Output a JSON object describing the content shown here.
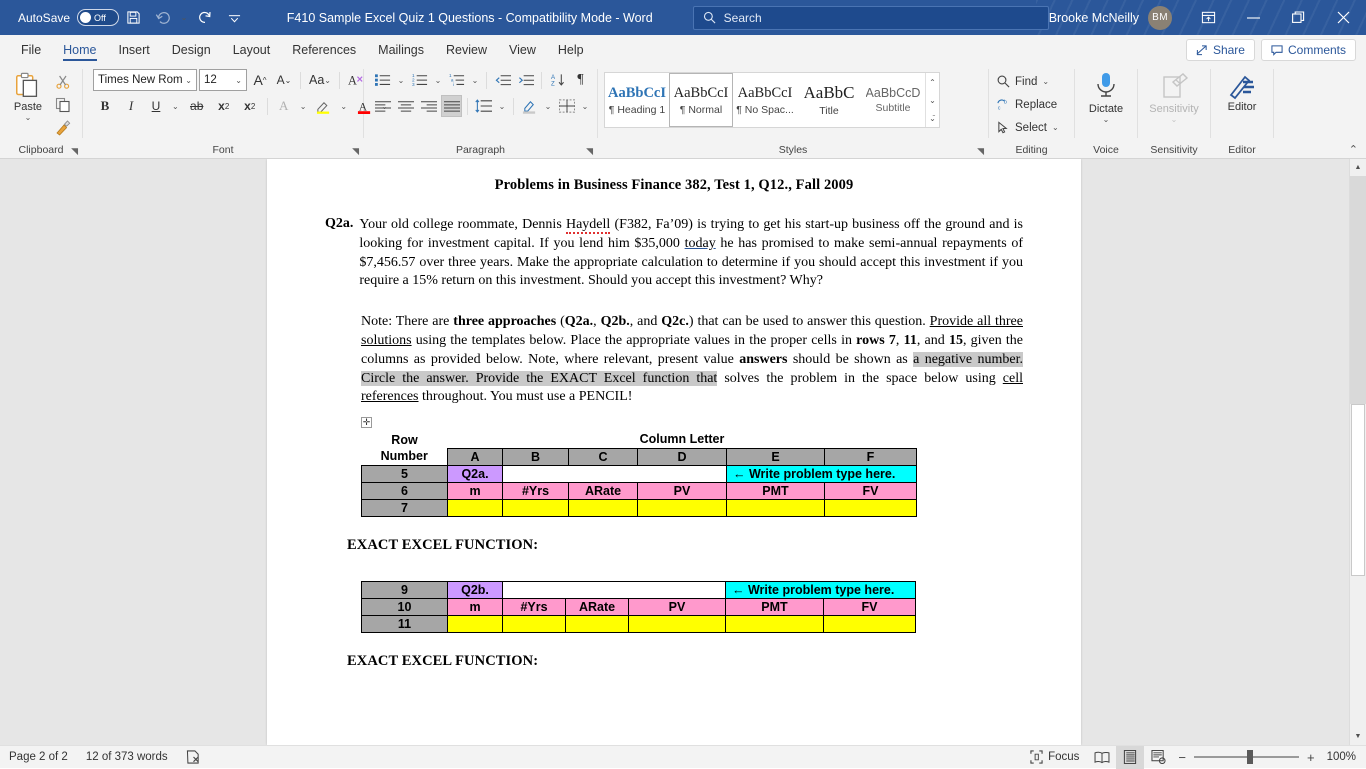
{
  "titlebar": {
    "autosave_label": "AutoSave",
    "autosave_state": "Off",
    "save_icon": "save-icon",
    "undo_icon": "undo-icon",
    "redo_icon": "redo-icon",
    "customize_icon": "customize-quick-access-icon",
    "document_title": "F410 Sample Excel Quiz 1 Questions  -  Compatibility Mode  -  Word",
    "search_placeholder": "Search",
    "search_icon": "search-icon",
    "user_name": "Brooke McNeilly",
    "user_initials": "BM",
    "ribbon_display_icon": "ribbon-display-options-icon",
    "minimize_icon": "minimize-icon",
    "restore_icon": "restore-icon",
    "close_icon": "close-icon"
  },
  "tabs": {
    "items": [
      {
        "label": "File",
        "active": false
      },
      {
        "label": "Home",
        "active": true
      },
      {
        "label": "Insert",
        "active": false
      },
      {
        "label": "Design",
        "active": false
      },
      {
        "label": "Layout",
        "active": false
      },
      {
        "label": "References",
        "active": false
      },
      {
        "label": "Mailings",
        "active": false
      },
      {
        "label": "Review",
        "active": false
      },
      {
        "label": "View",
        "active": false
      },
      {
        "label": "Help",
        "active": false
      }
    ],
    "share_label": "Share",
    "comments_label": "Comments"
  },
  "ribbon": {
    "clipboard": {
      "group_label": "Clipboard",
      "paste_label": "Paste",
      "cut_icon": "cut-scissors-icon",
      "copy_icon": "copy-icon",
      "format_painter_icon": "format-painter-icon"
    },
    "font": {
      "group_label": "Font",
      "font_name": "Times New Rom",
      "font_size": "12",
      "grow_font": "A",
      "shrink_font": "A",
      "change_case": "Aa",
      "clear_formatting_icon": "clear-formatting-icon",
      "bold": "B",
      "italic": "I",
      "underline": "U",
      "strikethrough": "ab",
      "subscript": "x",
      "superscript": "x",
      "text_effects": "A",
      "highlight_color": "A",
      "font_color": "A",
      "highlight_hex": "#ffff00",
      "font_color_hex": "#ff0000"
    },
    "paragraph": {
      "group_label": "Paragraph",
      "bullets_icon": "bullet-list-icon",
      "numbering_icon": "numbered-list-icon",
      "multilevel_icon": "multilevel-list-icon",
      "decrease_indent_icon": "decrease-indent-icon",
      "increase_indent_icon": "increase-indent-icon",
      "sort_icon": "sort-az-icon",
      "show_marks_icon": "show-formatting-marks-icon",
      "align_left_icon": "align-left-icon",
      "align_center_icon": "align-center-icon",
      "align_right_icon": "align-right-icon",
      "justify_icon": "justify-icon",
      "line_spacing_icon": "line-spacing-icon",
      "shading_icon": "shading-icon",
      "borders_icon": "borders-icon"
    },
    "styles": {
      "group_label": "Styles",
      "items": [
        {
          "preview": "AaBbCcI",
          "name": "¶ Heading 1",
          "selected": false
        },
        {
          "preview": "AaBbCcI",
          "name": "¶ Normal",
          "selected": true
        },
        {
          "preview": "AaBbCcI",
          "name": "¶ No Spac...",
          "selected": false
        },
        {
          "preview": "AaBbC",
          "name": "Title",
          "selected": false
        },
        {
          "preview": "AaBbCcD",
          "name": "Subtitle",
          "selected": false
        }
      ]
    },
    "editing": {
      "group_label": "Editing",
      "find_label": "Find",
      "replace_label": "Replace",
      "select_label": "Select",
      "find_icon": "search-icon",
      "replace_icon": "replace-icon",
      "select_icon": "cursor-select-icon"
    },
    "voice": {
      "group_label": "Voice",
      "dictate_label": "Dictate",
      "dictate_icon": "microphone-icon"
    },
    "sensitivity": {
      "group_label": "Sensitivity",
      "label": "Sensitivity",
      "icon": "sensitivity-icon"
    },
    "editor": {
      "group_label": "Editor",
      "label": "Editor",
      "icon": "editor-pen-icon"
    },
    "collapse_icon": "collapse-ribbon-icon"
  },
  "document": {
    "title": "Problems in Business Finance 382, Test 1, Q12., Fall 2009",
    "q2a_tag": "Q2a.",
    "q2a_text_1": "Your old college roommate, Dennis ",
    "q2a_haydell": "Haydell",
    "q2a_text_2": " (F382, Fa’09) is trying to get his start-up business off the ground and is looking for investment capital. If you lend him $35,000 ",
    "q2a_today": "today",
    "q2a_text_3": " he has promised to make semi-annual repayments of $7,456.57 over three years. Make the appropriate calculation to determine if you should accept this investment if you require a 15% return on this investment. Should you accept this investment? Why?",
    "note_1": "Note: There are ",
    "note_three_approaches": "three approaches",
    "note_2": " (",
    "note_q2a": "Q2a.",
    "note_3": ", ",
    "note_q2b": "Q2b.",
    "note_4": ", and ",
    "note_q2c": "Q2c.",
    "note_5": ") that can be used to answer this question. ",
    "note_provide": "Provide all three solutions",
    "note_6": " using the templates below. Place the appropriate values in the proper cells in ",
    "note_rows": "rows",
    "note_7": " ",
    "note_r7": "7",
    "note_8": ", ",
    "note_r11": "11",
    "note_9": ", and ",
    "note_r15": "15",
    "note_10": ", given the columns as provided below. Note, where relevant, present value ",
    "note_answers": "answers",
    "note_11": " should be shown as ",
    "note_highlighted": "a negative number. Circle the answer. Provide the EXACT Excel function that",
    "note_12": " solves the problem in the space below using ",
    "note_cell_refs": "cell references",
    "note_13": " throughout. You must use a PENCIL!",
    "table_handle_icon": "table-move-handle-icon",
    "row_number_header_line1": "Row",
    "row_number_header_line2": "Number",
    "column_letter_header": "Column Letter",
    "column_letters": [
      "A",
      "B",
      "C",
      "D",
      "E",
      "F"
    ],
    "table1": {
      "rows": [
        {
          "num": "5",
          "cells": [
            "Q2a.",
            "",
            "",
            "",
            "← Write problem type here.",
            ""
          ],
          "styles": [
            "purple",
            "white",
            "white",
            "white",
            "cyan",
            "cyan"
          ],
          "merge": [
            1,
            3,
            0,
            0,
            2,
            0
          ]
        },
        {
          "num": "6",
          "cells": [
            "m",
            "#Yrs",
            "ARate",
            "PV",
            "PMT",
            "FV"
          ],
          "styles": [
            "pink",
            "pink",
            "pink",
            "pink",
            "pink",
            "pink"
          ]
        },
        {
          "num": "7",
          "cells": [
            "",
            "",
            "",
            "",
            "",
            ""
          ],
          "styles": [
            "yellow",
            "yellow",
            "yellow",
            "yellow",
            "yellow",
            "yellow"
          ]
        }
      ]
    },
    "exact_excel_function_1": "EXACT EXCEL FUNCTION:",
    "table2": {
      "rows": [
        {
          "num": "9",
          "cells": [
            "Q2b.",
            "",
            "",
            "",
            "← Write problem type here.",
            ""
          ],
          "styles": [
            "purple",
            "white",
            "white",
            "white",
            "cyan",
            "cyan"
          ]
        },
        {
          "num": "10",
          "cells": [
            "m",
            "#Yrs",
            "ARate",
            "PV",
            "PMT",
            "FV"
          ],
          "styles": [
            "pink",
            "pink",
            "pink",
            "pink",
            "pink",
            "pink"
          ]
        },
        {
          "num": "11",
          "cells": [
            "",
            "",
            "",
            "",
            "",
            ""
          ],
          "styles": [
            "yellow",
            "yellow",
            "yellow",
            "yellow",
            "yellow",
            "yellow"
          ]
        }
      ]
    },
    "exact_excel_function_2": "EXACT EXCEL FUNCTION:"
  },
  "status": {
    "page_label": "Page 2 of 2",
    "word_count": "12 of 373 words",
    "proofing_icon": "proofing-errors-icon",
    "focus_label": "Focus",
    "focus_icon": "focus-mode-icon",
    "read_mode_icon": "read-mode-icon",
    "print_layout_icon": "print-layout-icon",
    "web_layout_icon": "web-layout-icon",
    "zoom_out": "−",
    "zoom_in": "+",
    "zoom_value": "100%"
  }
}
